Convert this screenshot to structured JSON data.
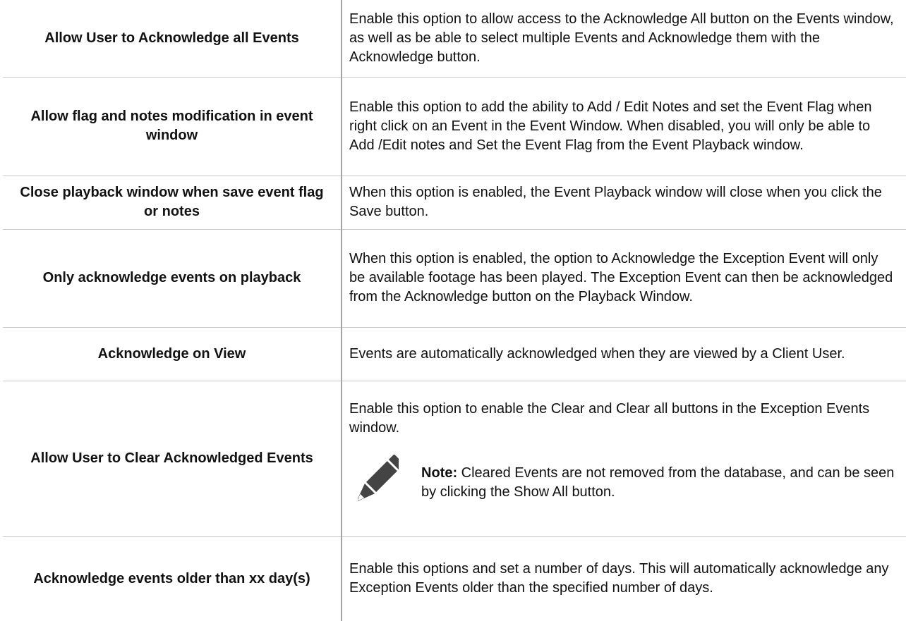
{
  "rows": [
    {
      "setting": "Allow User to Acknowledge all Events",
      "description": "Enable this option to allow access to the Acknowledge All button on the Events window, as well as be able to select multiple Events and Acknowledge them with the Acknowledge button."
    },
    {
      "setting": "Allow flag and notes modification in event window",
      "description": "Enable this option to add the ability to Add / Edit Notes and set the Event Flag when right click on an Event in the Event Window.  When disabled, you will only be able to Add /Edit notes and Set the Event Flag from the Event Playback window."
    },
    {
      "setting": "Close playback window when save event flag or notes",
      "description": "When this option is enabled, the Event Playback window will close when you click the Save button."
    },
    {
      "setting": "Only acknowledge events on playback",
      "description": "When this option is enabled, the option to Acknowledge the Exception Event will only be available footage has been played.  The Exception Event can then be acknowledged from the Acknowledge button on the Playback Window."
    },
    {
      "setting": "Acknowledge on View",
      "description": "Events are automatically acknowledged when they are viewed by a Client User."
    },
    {
      "setting": "Allow User to Clear Acknowledged Events",
      "description": "Enable this option to enable the Clear and Clear all buttons in the Exception Events window.",
      "note": {
        "icon": "pencil-icon",
        "label": "Note:",
        "text": "Cleared Events are not removed from the database, and can be seen by clicking the Show All button."
      }
    },
    {
      "setting": "Acknowledge events older than xx day(s)",
      "description": "Enable this options and set a number of days.  This will automatically acknowledge any Exception Events older than the specified number of days."
    }
  ]
}
